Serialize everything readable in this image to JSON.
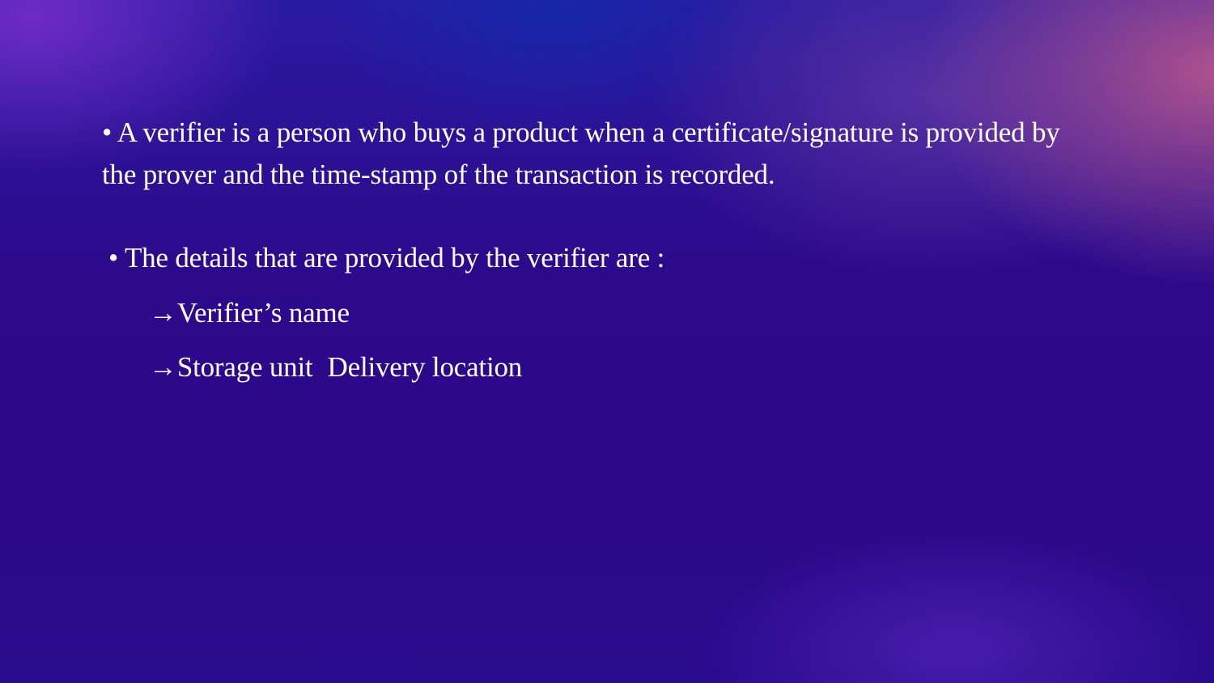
{
  "slide": {
    "bullet_char": "•",
    "arrow_char": "→",
    "point1": "A verifier is a person who buys a product when a certificate/signature is provided by the prover and the time-stamp of the transaction is recorded.",
    "point2": "The details that are provided by the verifier are :",
    "sub_items": [
      "Verifier’s name",
      "Storage unit",
      "Delivery location"
    ]
  },
  "colors": {
    "text": "#ffffff",
    "background_base": "#2c0888",
    "accent_top_right": "#c45c8c"
  }
}
